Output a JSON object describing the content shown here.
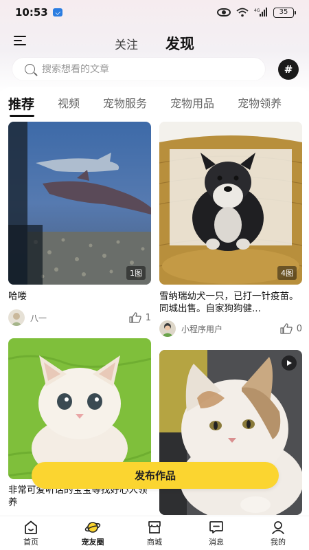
{
  "status_bar": {
    "time": "10:53",
    "battery": "35",
    "network": "4G"
  },
  "header": {
    "tabs": [
      {
        "label": "关注",
        "active": false
      },
      {
        "label": "发现",
        "active": true
      }
    ]
  },
  "search": {
    "placeholder": "搜索想看的文章"
  },
  "categories": [
    {
      "label": "推荐",
      "active": true
    },
    {
      "label": "视频",
      "active": false
    },
    {
      "label": "宠物服务",
      "active": false
    },
    {
      "label": "宠物用品",
      "active": false
    },
    {
      "label": "宠物领养",
      "active": false
    }
  ],
  "posts": [
    {
      "title": "哈喽",
      "image_count": "1图",
      "author": "八一",
      "likes": "1",
      "image": "shark aquarium"
    },
    {
      "title": "雪纳瑞幼犬一只，已打一针疫苗。同城出售。自家狗狗健...",
      "image_count": "4图",
      "author": "小程序用户",
      "likes": "0",
      "image": "schnauzer puppy on wicker chair"
    },
    {
      "title": "非常可爱听话的宝宝等找好心人领养",
      "image_count": "",
      "author": "",
      "likes": "",
      "image": "white kitten on green blanket"
    },
    {
      "title": "",
      "image_count": "",
      "author": "",
      "likes": "",
      "image": "calico kitten",
      "is_video": true
    }
  ],
  "publish_button": "发布作品",
  "bottom_nav": [
    {
      "label": "首页",
      "icon": "home-icon",
      "active": false
    },
    {
      "label": "宠友圈",
      "icon": "planet-icon",
      "active": true
    },
    {
      "label": "商城",
      "icon": "store-icon",
      "active": false
    },
    {
      "label": "消息",
      "icon": "message-icon",
      "active": false
    },
    {
      "label": "我的",
      "icon": "profile-icon",
      "active": false
    }
  ],
  "colors": {
    "accent": "#fbd530",
    "text_primary": "#111111",
    "text_secondary": "#666666"
  }
}
